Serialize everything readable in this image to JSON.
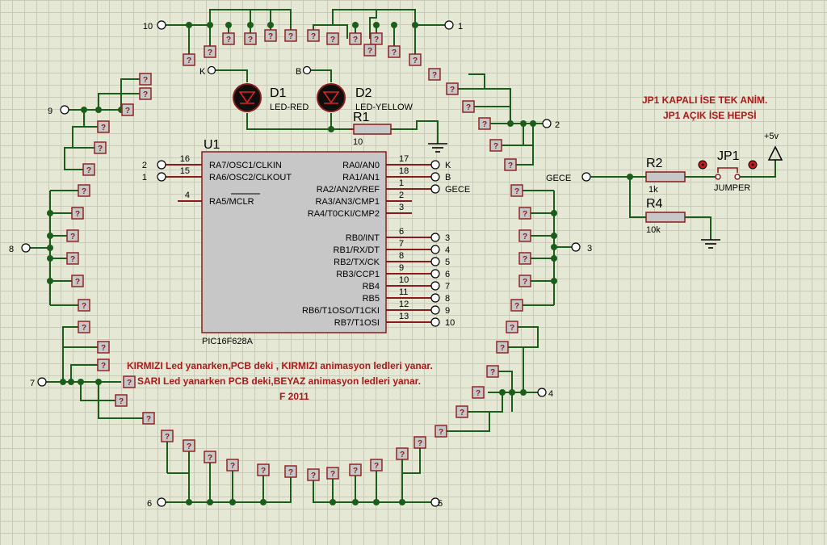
{
  "schematic": {
    "chip": {
      "ref": "U1",
      "part": "PIC16F628A",
      "left_pins": [
        {
          "net": "2",
          "num": "16",
          "name": "RA7/OSC1/CLKIN"
        },
        {
          "net": "1",
          "num": "15",
          "name": "RA6/OSC2/CLKOUT"
        },
        {
          "net": "",
          "num": "4",
          "name": "RA5/MCLR"
        }
      ],
      "right_pins": [
        {
          "num": "17",
          "name": "RA0/AN0",
          "net": "K"
        },
        {
          "num": "18",
          "name": "RA1/AN1",
          "net": "B"
        },
        {
          "num": "1",
          "name": "RA2/AN2/VREF",
          "net": "GECE"
        },
        {
          "num": "2",
          "name": "RA3/AN3/CMP1",
          "net": ""
        },
        {
          "num": "3",
          "name": "RA4/T0CKI/CMP2",
          "net": ""
        },
        {
          "num": "6",
          "name": "RB0/INT",
          "net": "3"
        },
        {
          "num": "7",
          "name": "RB1/RX/DT",
          "net": "4"
        },
        {
          "num": "8",
          "name": "RB2/TX/CK",
          "net": "5"
        },
        {
          "num": "9",
          "name": "RB3/CCP1",
          "net": "6"
        },
        {
          "num": "10",
          "name": "RB4",
          "net": "7"
        },
        {
          "num": "11",
          "name": "RB5",
          "net": "8"
        },
        {
          "num": "12",
          "name": "RB6/T1OSO/T1CKI",
          "net": "9"
        },
        {
          "num": "13",
          "name": "RB7/T1OSI",
          "net": "10"
        }
      ]
    },
    "leds": {
      "d1": {
        "ref": "D1",
        "type": "LED-RED",
        "terminal": "K"
      },
      "d2": {
        "ref": "D2",
        "type": "LED-YELLOW",
        "terminal": "B"
      }
    },
    "r1": {
      "ref": "R1",
      "value": "10"
    },
    "r2": {
      "ref": "R2",
      "value": "1k"
    },
    "r4": {
      "ref": "R4",
      "value": "10k"
    },
    "jp1": {
      "ref": "JP1",
      "type": "JUMPER"
    },
    "gece_label": "GECE",
    "power_label": "+5v",
    "notes": {
      "jp1_line1": "JP1 KAPALI İSE TEK ANİM.",
      "jp1_line2": "JP1 AÇIK İSE HEPSİ",
      "line1": "KIRMIZI Led yanarken,PCB deki , KIRMIZI animasyon ledleri yanar.",
      "line2": "SARI Led yanarken PCB deki,BEYAZ animasyon ledleri yanar.",
      "line3": "F 2011"
    },
    "ring_terminals": [
      "1",
      "2",
      "3",
      "4",
      "5",
      "6",
      "7",
      "8",
      "9",
      "10"
    ],
    "unknown_part_symbol": "?",
    "colors": {
      "wire": "#1b5e1b",
      "component": "#8b1a1a",
      "component_fill": "#c7c7c7",
      "note_text": "#b01818",
      "background": "#e6e8d6"
    }
  }
}
